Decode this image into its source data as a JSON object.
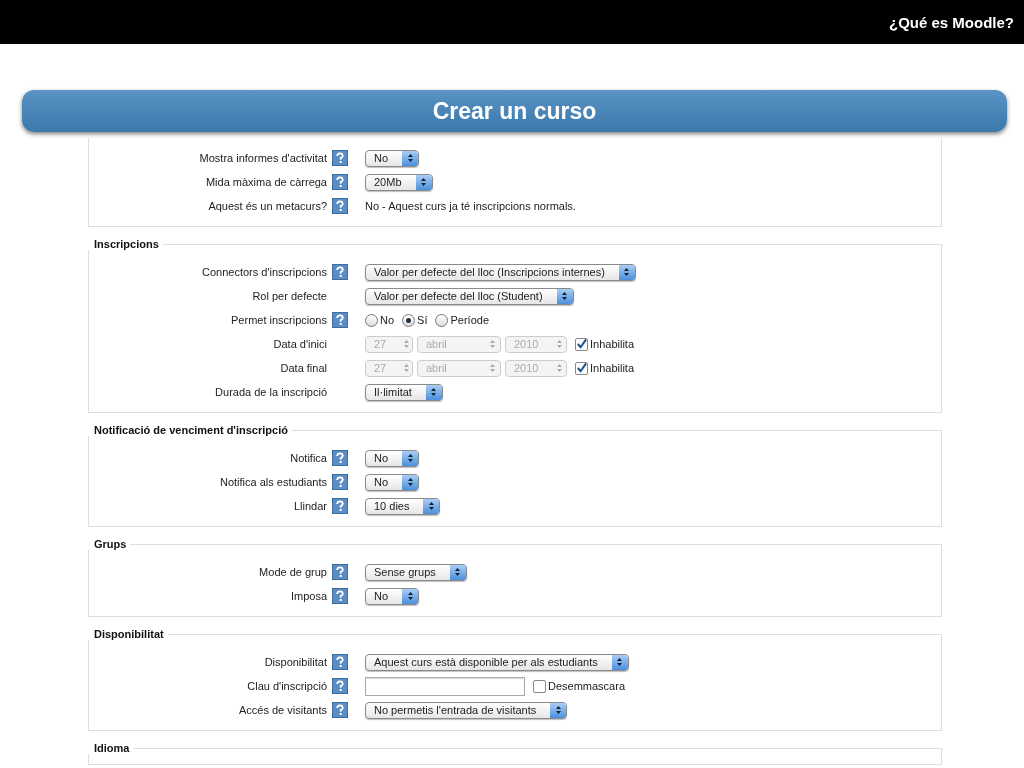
{
  "header": {
    "title": "¿Qué es Moodle?"
  },
  "banner": {
    "title": "Crear un curso"
  },
  "sections": [
    {
      "rows": [
        {
          "label": "Mostra informes d'activitat",
          "help": true,
          "control": {
            "kind": "select",
            "value": "No"
          }
        },
        {
          "label": "Mida màxima de càrrega",
          "help": true,
          "control": {
            "kind": "select",
            "value": "20Mb"
          }
        },
        {
          "label": "Aquest és un metacurs?",
          "help": true,
          "control": {
            "kind": "text",
            "text": "No - Aquest curs ja té inscripcions normals."
          }
        }
      ]
    },
    {
      "legend": "Inscripcions",
      "rows": [
        {
          "label": "Connectors d'inscripcions",
          "help": true,
          "control": {
            "kind": "select",
            "value": "Valor per defecte del lloc (Inscripcions internes)"
          }
        },
        {
          "label": "Rol per defecte",
          "help": false,
          "control": {
            "kind": "select",
            "value": "Valor per defecte del lloc (Student)"
          }
        },
        {
          "label": "Permet inscripcions",
          "help": true,
          "control": {
            "kind": "radios",
            "options": [
              {
                "label": "No",
                "selected": false
              },
              {
                "label": "Sí",
                "selected": true
              },
              {
                "label": "Període",
                "selected": false
              }
            ]
          }
        },
        {
          "label": "Data d'inici",
          "help": false,
          "control": {
            "kind": "date",
            "disabled": true,
            "fields": [
              "27",
              "abril",
              "2010"
            ],
            "checkbox": {
              "label": "Inhabilita",
              "checked": true
            }
          }
        },
        {
          "label": "Data final",
          "help": false,
          "control": {
            "kind": "date",
            "disabled": true,
            "fields": [
              "27",
              "abril",
              "2010"
            ],
            "checkbox": {
              "label": "Inhabilita",
              "checked": true
            }
          }
        },
        {
          "label": "Durada de la inscripció",
          "help": false,
          "control": {
            "kind": "select",
            "value": "Il·limitat"
          }
        }
      ]
    },
    {
      "legend": "Notificació de venciment d'inscripció",
      "rows": [
        {
          "label": "Notifica",
          "help": true,
          "control": {
            "kind": "select",
            "value": "No"
          }
        },
        {
          "label": "Notifica als estudiants",
          "help": true,
          "control": {
            "kind": "select",
            "value": "No"
          }
        },
        {
          "label": "Llindar",
          "help": true,
          "control": {
            "kind": "select",
            "value": "10 dies"
          }
        }
      ]
    },
    {
      "legend": "Grups",
      "rows": [
        {
          "label": "Mode de grup",
          "help": true,
          "control": {
            "kind": "select",
            "value": "Sense grups"
          }
        },
        {
          "label": "Imposa",
          "help": true,
          "control": {
            "kind": "select",
            "value": "No"
          }
        }
      ]
    },
    {
      "legend": "Disponibilitat",
      "rows": [
        {
          "label": "Disponibilitat",
          "help": true,
          "control": {
            "kind": "select",
            "value": "Aquest curs està disponible per als estudiants"
          }
        },
        {
          "label": "Clau d'inscripció",
          "help": true,
          "control": {
            "kind": "password",
            "checkbox": {
              "label": "Desemmascara",
              "checked": false
            }
          }
        },
        {
          "label": "Accés de visitants",
          "help": true,
          "control": {
            "kind": "select",
            "value": "No permetis l'entrada de visitants"
          }
        }
      ]
    },
    {
      "legend": "Idioma"
    }
  ]
}
